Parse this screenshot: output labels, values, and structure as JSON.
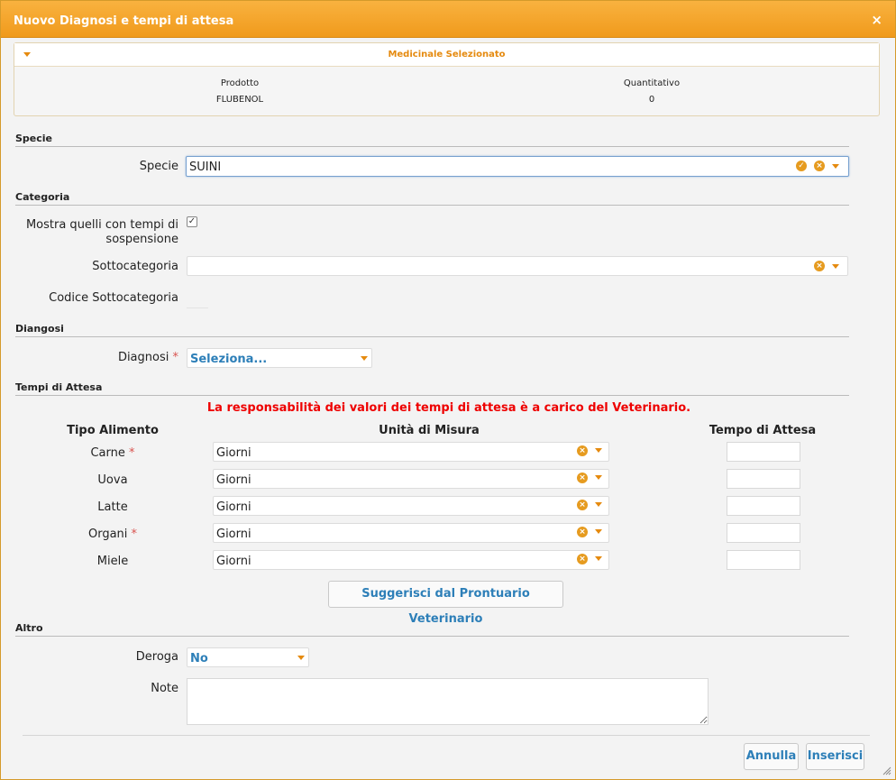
{
  "dialog": {
    "title": "Nuovo Diagnosi e tempi di attesa",
    "close_glyph": "×"
  },
  "medicinale": {
    "header": "Medicinale Selezionato",
    "col_prodotto": "Prodotto",
    "col_quantitativo": "Quantitativo",
    "prodotto": "FLUBENOL",
    "quantitativo": "0"
  },
  "sections": {
    "specie": "Specie",
    "categoria": "Categoria",
    "diagnosi": "Diangosi",
    "tempi": "Tempi di Attesa",
    "altro": "Altro"
  },
  "specie": {
    "label": "Specie",
    "value": "SUINI"
  },
  "categoria": {
    "mostra_label_1": "Mostra quelli con tempi di",
    "mostra_label_2": "sospensione",
    "mostra_checked": "✓",
    "sottocategoria_label": "Sottocategoria",
    "sottocategoria_value": "",
    "codice_label": "Codice Sottocategoria"
  },
  "diagnosi": {
    "label": "Diagnosi",
    "required_mark": "*",
    "value": "Seleziona..."
  },
  "tempi": {
    "warning": "La responsabilità dei valori dei tempi di attesa è a carico del Veterinario.",
    "col_tipo": "Tipo Alimento",
    "col_unita": "Unità di Misura",
    "col_tempo": "Tempo di Attesa",
    "rows": [
      {
        "tipo": "Carne",
        "required": "*",
        "unita": "Giorni",
        "tempo": ""
      },
      {
        "tipo": "Uova",
        "required": "",
        "unita": "Giorni",
        "tempo": ""
      },
      {
        "tipo": "Latte",
        "required": "",
        "unita": "Giorni",
        "tempo": ""
      },
      {
        "tipo": "Organi",
        "required": "*",
        "unita": "Giorni",
        "tempo": ""
      },
      {
        "tipo": "Miele",
        "required": "",
        "unita": "Giorni",
        "tempo": ""
      }
    ],
    "suggerisci_label": "Suggerisci dal Prontuario Veterinario"
  },
  "altro": {
    "deroga_label": "Deroga",
    "deroga_value": "No",
    "note_label": "Note",
    "note_value": ""
  },
  "footer": {
    "annulla": "Annulla",
    "inserisci": "Inserisci"
  },
  "colors": {
    "accent": "#f09a1c",
    "link": "#2d7fb8",
    "warning": "#e00000"
  }
}
